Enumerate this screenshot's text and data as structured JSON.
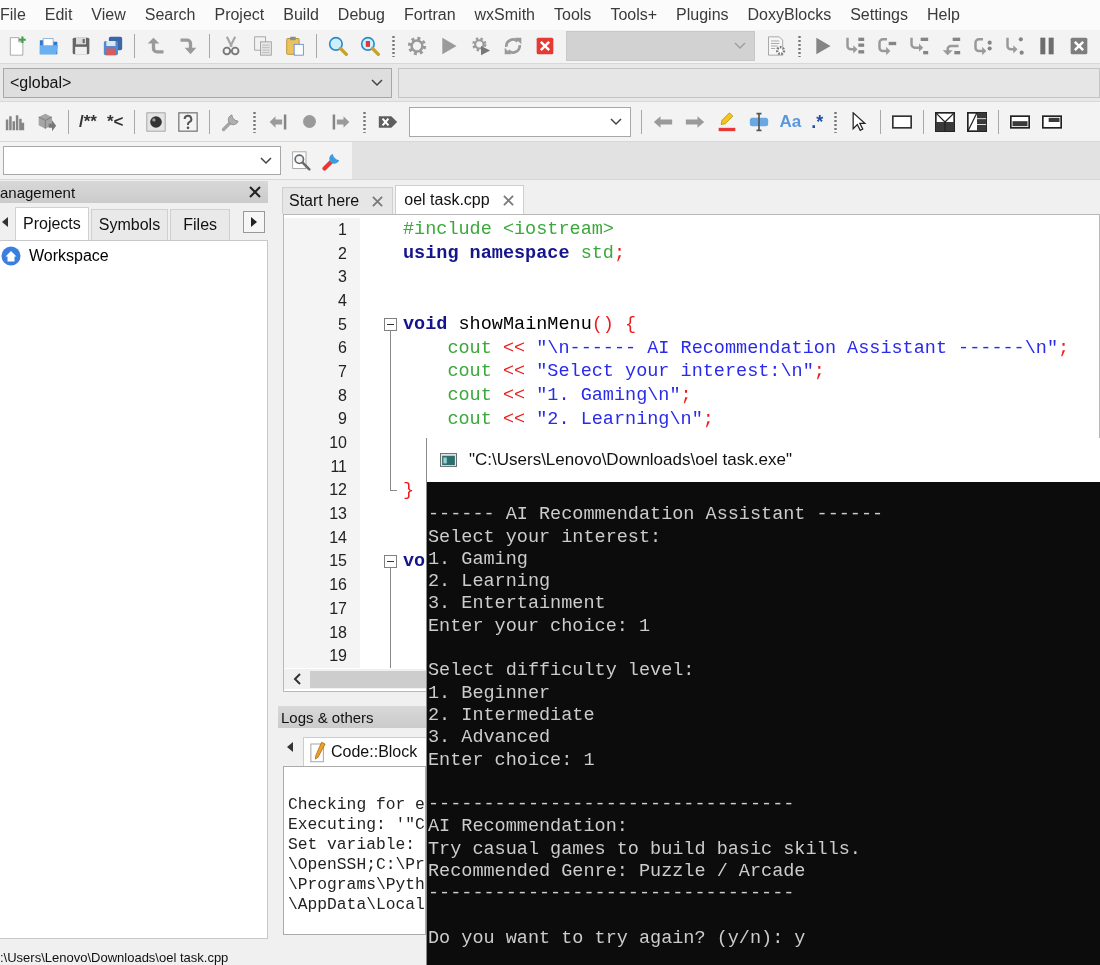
{
  "menu": [
    "File",
    "Edit",
    "View",
    "Search",
    "Project",
    "Build",
    "Debug",
    "Fortran",
    "wxSmith",
    "Tools",
    "Tools+",
    "Plugins",
    "DoxyBlocks",
    "Settings",
    "Help"
  ],
  "toolbar": {
    "build_target": {
      "disabled": true
    },
    "scope": "<global>",
    "doxy_buttons": [
      "/**",
      "*<"
    ],
    "match_case": "Aa",
    "regex": ".*"
  },
  "management": {
    "title": "anagement",
    "tabs": [
      {
        "label": "Projects",
        "selected": true
      },
      {
        "label": "Symbols",
        "selected": false
      },
      {
        "label": "Files",
        "selected": false
      }
    ],
    "tree": [
      {
        "label": "Workspace"
      }
    ]
  },
  "editor": {
    "tabs": [
      {
        "label": "Start here",
        "selected": false
      },
      {
        "label": "oel task.cpp",
        "selected": true
      }
    ],
    "lines": [
      {
        "n": "1",
        "kind": "plain",
        "tokens": [
          {
            "kind": "preprocessor",
            "text": "#include <iostream>"
          }
        ]
      },
      {
        "n": "2",
        "kind": "plain",
        "tokens": [
          {
            "kind": "keyword",
            "text": "using namespace "
          },
          {
            "kind": "library",
            "text": "std"
          },
          {
            "kind": "operator",
            "text": ";"
          }
        ]
      },
      {
        "n": "3",
        "kind": "plain"
      },
      {
        "n": "4",
        "kind": "plain"
      },
      {
        "n": "5",
        "kind": "block",
        "expanded": true,
        "tokens": [
          {
            "kind": "keyword",
            "text": "void "
          },
          {
            "kind": "identifier",
            "text": "showMainMenu"
          },
          {
            "kind": "operator",
            "text": "() {"
          }
        ],
        "children": [
          {
            "n": "6",
            "kind": "plain",
            "tokens": [
              {
                "kind": "library",
                "text": "cout "
              },
              {
                "kind": "operator",
                "text": "<< "
              },
              {
                "kind": "string",
                "text": "\"\\n------ AI Recommendation Assistant ------\\n\""
              },
              {
                "kind": "operator",
                "text": ";"
              }
            ]
          },
          {
            "n": "7",
            "kind": "plain",
            "tokens": [
              {
                "kind": "library",
                "text": "cout "
              },
              {
                "kind": "operator",
                "text": "<< "
              },
              {
                "kind": "string",
                "text": "\"Select your interest:\\n\""
              },
              {
                "kind": "operator",
                "text": ";"
              }
            ]
          },
          {
            "n": "8",
            "kind": "plain",
            "tokens": [
              {
                "kind": "library",
                "text": "cout "
              },
              {
                "kind": "operator",
                "text": "<< "
              },
              {
                "kind": "string",
                "text": "\"1. Gaming\\n\""
              },
              {
                "kind": "operator",
                "text": ";"
              }
            ]
          },
          {
            "n": "9",
            "kind": "plain",
            "tokens": [
              {
                "kind": "library",
                "text": "cout "
              },
              {
                "kind": "operator",
                "text": "<< "
              },
              {
                "kind": "string",
                "text": "\"2. Learning\\n\""
              },
              {
                "kind": "operator",
                "text": ";"
              }
            ]
          },
          {
            "n": "10",
            "kind": "plain"
          },
          {
            "n": "11",
            "kind": "plain"
          }
        ]
      },
      {
        "n": "12",
        "kind": "close",
        "tokens": [
          {
            "kind": "operator",
            "text": "}"
          }
        ]
      },
      {
        "n": "13",
        "kind": "plain"
      },
      {
        "n": "14",
        "kind": "plain"
      },
      {
        "n": "15",
        "kind": "block",
        "expanded": true,
        "tokens": [
          {
            "kind": "keyword",
            "text": "vo"
          }
        ],
        "children": [
          {
            "n": "16",
            "kind": "plain"
          },
          {
            "n": "17",
            "kind": "plain"
          },
          {
            "n": "18",
            "kind": "plain"
          },
          {
            "n": "19",
            "kind": "plain"
          }
        ]
      }
    ]
  },
  "logs": {
    "title": "Logs & others",
    "tabs": [
      {
        "label": "Code::Block",
        "selected": true
      }
    ],
    "lines": [
      "Checking for e",
      "Executing: '\"C",
      "Set variable:",
      "\\OpenSSH;C:\\Pr",
      "\\Programs\\Pyth",
      "\\AppData\\Local"
    ]
  },
  "console": {
    "title": "\"C:\\Users\\Lenovo\\Downloads\\oel task.exe\"",
    "blocks": [
      [
        "------ AI Recommendation Assistant ------",
        "Select your interest:",
        "1. Gaming",
        "2. Learning",
        "3. Entertainment",
        "Enter your choice: 1"
      ],
      [
        "Select difficulty level:",
        "1. Beginner",
        "2. Intermediate",
        "3. Advanced",
        "Enter choice: 1"
      ],
      [
        "---------------------------------",
        "AI Recommendation:",
        "Try casual games to build basic skills.",
        "Recommended Genre: Puzzle / Arcade",
        "---------------------------------"
      ],
      [
        "Do you want to try again? (y/n): y"
      ]
    ]
  },
  "status_bar": {
    "path": ":\\Users\\Lenovo\\Downloads\\oel task.cpp"
  }
}
